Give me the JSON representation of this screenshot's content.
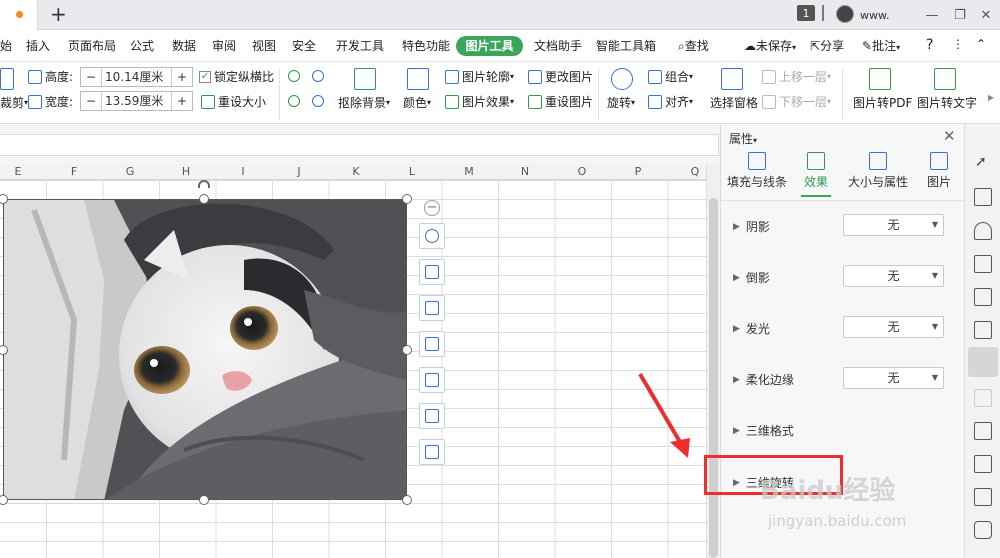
{
  "titlebar": {
    "badge": "1",
    "user": "www."
  },
  "menu": {
    "items": [
      "始",
      "插入",
      "页面布局",
      "公式",
      "数据",
      "审阅",
      "视图",
      "安全",
      "开发工具",
      "特色功能"
    ],
    "active": "图片工具",
    "items2": [
      "文档助手",
      "智能工具箱"
    ],
    "search": "查找",
    "unsaved": "未保存",
    "share": "分享",
    "comment": "批注"
  },
  "ribbon": {
    "height_label": "高度:",
    "height_value": "10.14厘米",
    "width_label": "宽度:",
    "width_value": "13.59厘米",
    "lock_ratio": "锁定纵横比",
    "reset_size": "重设大小",
    "crop": "裁剪",
    "remove_bg": "抠除背景",
    "color": "颜色",
    "outline": "图片轮廓",
    "effect": "图片效果",
    "change_pic": "更改图片",
    "reset_pic": "重设图片",
    "rotate": "旋转",
    "group": "组合",
    "align": "对齐",
    "select_pane": "选择窗格",
    "up_layer": "上移一层",
    "down_layer": "下移一层",
    "to_pdf": "图片转PDF",
    "to_text": "图片转文字"
  },
  "sheet": {
    "columns": [
      "E",
      "F",
      "G",
      "H",
      "I",
      "J",
      "K",
      "L",
      "M",
      "N",
      "O",
      "P",
      "Q"
    ]
  },
  "panel": {
    "title": "属性",
    "tabs": [
      "填充与线条",
      "效果",
      "大小与属性",
      "图片"
    ],
    "rows": [
      {
        "label": "阴影",
        "value": "无"
      },
      {
        "label": "倒影",
        "value": "无"
      },
      {
        "label": "发光",
        "value": "无"
      },
      {
        "label": "柔化边缘",
        "value": "无"
      },
      {
        "label": "三维格式"
      },
      {
        "label": "三维旋转"
      }
    ]
  },
  "watermark": {
    "main": "Baidu经验",
    "sub": "jingyan.baidu.com"
  }
}
